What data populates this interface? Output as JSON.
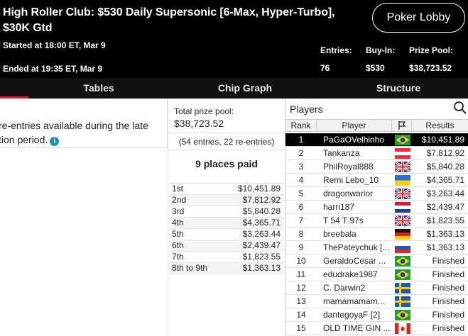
{
  "header": {
    "title": "High Roller Club: $530 Daily Supersonic [6-Max, Hyper-Turbo], $30K Gtd",
    "started": "Started at 18:00 ET, Mar 9",
    "ended": "Ended at 19:35 ET, Mar 9",
    "lobby_button": "Poker Lobby",
    "entries_label": "Entries:",
    "entries_value": "76",
    "buyin_label": "Buy-In:",
    "buyin_value": "$530",
    "prize_label": "Prize Pool:",
    "prize_value": "$38,723.52"
  },
  "tabs": [
    "Tables",
    "Chip Graph",
    "Structure"
  ],
  "left": {
    "reentry_text": "re-entries available during the late",
    "reentry_text_2": "tion period."
  },
  "prize": {
    "pool_label": "Total prize pool:",
    "pool_value": "$38,723.52",
    "entries_note": "(54 entries, 22 re-entries)",
    "places_paid": "9 places paid",
    "payouts": [
      {
        "place": "1st",
        "amount": "$10,451.89"
      },
      {
        "place": "2nd",
        "amount": "$7,812.92"
      },
      {
        "place": "3rd",
        "amount": "$5,840.28"
      },
      {
        "place": "4th",
        "amount": "$4,365.71"
      },
      {
        "place": "5th",
        "amount": "$3,263.44"
      },
      {
        "place": "6th",
        "amount": "$2,439.47"
      },
      {
        "place": "7th",
        "amount": "$1,823.55"
      },
      {
        "place": "8th to 9th",
        "amount": "$1,363.13"
      }
    ]
  },
  "players": {
    "title": "Players",
    "col_rank": "Rank",
    "col_player": "Player",
    "col_results": "Results",
    "rows": [
      {
        "rank": "1",
        "name": "PaGaOVelhinho",
        "flag": "brazil",
        "result": "$10,451.89"
      },
      {
        "rank": "2",
        "name": "Tankanza",
        "flag": "austria",
        "result": "$7,812.92"
      },
      {
        "rank": "3",
        "name": "PhilRoyal888",
        "flag": "uk",
        "result": "$5,840.28"
      },
      {
        "rank": "4",
        "name": "Remi Lebo_10",
        "flag": "ukraine",
        "result": "$4,365.71"
      },
      {
        "rank": "5",
        "name": "dragonwarior",
        "flag": "uk",
        "result": "$3,263.44"
      },
      {
        "rank": "6",
        "name": "harri187",
        "flag": "netherlands",
        "result": "$2,439.47"
      },
      {
        "rank": "7",
        "name": "T 54 T 97s",
        "flag": "uk",
        "result": "$1,823.55"
      },
      {
        "rank": "8",
        "name": "breebala",
        "flag": "germany",
        "result": "$1,363.13"
      },
      {
        "rank": "9",
        "name": "ThePateychuk [...",
        "flag": "russia",
        "result": "$1,363.13"
      },
      {
        "rank": "10",
        "name": "GeraldoCesar ...",
        "flag": "brazil",
        "result": "Finished"
      },
      {
        "rank": "11",
        "name": "edudrake1987",
        "flag": "brazil",
        "result": "Finished"
      },
      {
        "rank": "12",
        "name": "C. Darwin2",
        "flag": "sweden",
        "result": "Finished"
      },
      {
        "rank": "13",
        "name": "mamamamam...",
        "flag": "sweden",
        "result": "Finished"
      },
      {
        "rank": "14",
        "name": "dantegoyaF [2]",
        "flag": "brazil",
        "result": "Finished"
      },
      {
        "rank": "15",
        "name": "OLD TIME GIN ...",
        "flag": "canada",
        "result": "Finished"
      }
    ]
  },
  "colors": {
    "header_bg": "#000000",
    "tab_bar_bg": "#111111",
    "accent_red": "#d2203a",
    "info_blue": "#1b8fb5"
  }
}
